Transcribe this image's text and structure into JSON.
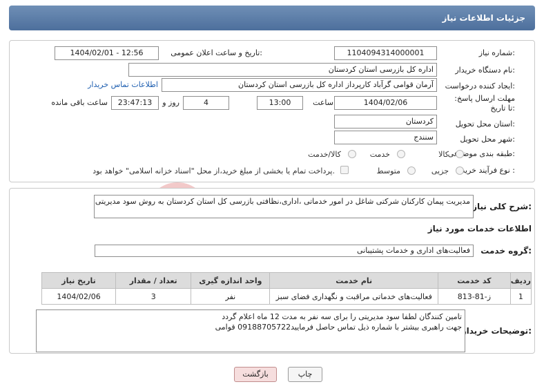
{
  "header": {
    "title": "جزئیات اطلاعات نیاز"
  },
  "form": {
    "need_number_label": "شماره نیاز:",
    "need_number": "1104094314000001",
    "announce_label": "تاریخ و ساعت اعلان عمومی:",
    "announce_value": "1404/02/01 - 12:56",
    "buyer_org_label": "نام دستگاه خریدار:",
    "buyer_org": "اداره کل بازرسی استان کردستان",
    "creator_label": "ایجاد کننده درخواست:",
    "creator": "آرمان قوامی گرآباد کارپرداز اداره کل بازرسی استان کردستان",
    "contact_link": "اطلاعات تماس خریدار",
    "deadline_label": "مهلت ارسال پاسخ: تا تاریخ:",
    "deadline_date": "1404/02/06",
    "time_label": "ساعت",
    "deadline_time": "13:00",
    "days_value": "4",
    "days_label": "روز و",
    "remaining_time": "23:47:13",
    "remaining_label": "ساعت باقی مانده",
    "province_label": "استان محل تحویل:",
    "province": "کردستان",
    "city_label": "شهر محل تحویل:",
    "city": "سنندج",
    "category_label": "طبقه بندی موضوعی:",
    "category_options": [
      "کالا",
      "خدمت",
      "کالا/خدمت"
    ],
    "process_label": "نوع فرآیند خرید :",
    "process_options": [
      "جزیی",
      "متوسط"
    ],
    "process_note": "پرداخت تمام یا بخشی از مبلغ خرید،از محل \"اسناد خزانه اسلامی\" خواهد بود."
  },
  "details": {
    "summary_label": "شرح کلی نیاز:",
    "summary": "مدیریت پیمان کارکنان شرکتی شاغل در امور خدماتی ،اداری،نظافتی بازرسی کل استان کردستان به روش سود مدیریتی",
    "services_heading": "اطلاعات خدمات مورد نیاز",
    "service_group_label": "گروه خدمت:",
    "service_group": "فعالیت‌های اداری و خدمات پشتیبانی",
    "table": {
      "headers": [
        "ردیف",
        "کد خدمت",
        "نام خدمت",
        "واحد اندازه گیری",
        "تعداد / مقدار",
        "تاریخ نیاز"
      ],
      "rows": [
        [
          "1",
          "ز-81-813",
          "فعالیت‌های خدماتی مراقبت و نگهداری فضای سبز",
          "نفر",
          "3",
          "1404/02/06"
        ]
      ]
    },
    "buyer_notes_label": "توضیحات خریدار:",
    "buyer_notes_line1": "تامین کنندگان لطفا سود مدیریتی را برای سه نفر به مدت 12 ماه اعلام گردد",
    "buyer_notes_line2": "جهت راهبری بیشتر با شماره ذیل تماس حاصل فرمایید09188705722 قوامی"
  },
  "buttons": {
    "print": "چاپ",
    "back": "بازگشت"
  },
  "colors": {
    "header": "#5b7ba6",
    "link": "#1f5fb0",
    "back_button": "#f6dede"
  }
}
